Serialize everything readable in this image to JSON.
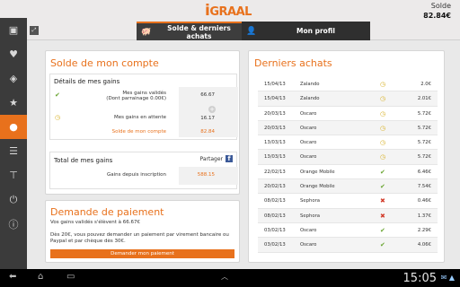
{
  "logo": {
    "first": "i",
    "rest": "GRAAL"
  },
  "header": {
    "solde_label": "Solde",
    "solde_value": "82.84€"
  },
  "tabs": [
    {
      "label": "Solde & derniers achats",
      "icon": "piggy-bank-icon",
      "active": true
    },
    {
      "label": "Mon profil",
      "icon": "person-icon",
      "active": false
    }
  ],
  "sidebar": {
    "items": [
      {
        "icon": "store-icon",
        "glyph": "▣"
      },
      {
        "icon": "heart-icon",
        "glyph": "♥"
      },
      {
        "icon": "tag-icon",
        "glyph": "◈"
      },
      {
        "icon": "star-icon",
        "glyph": "★"
      },
      {
        "icon": "user-icon",
        "glyph": "●",
        "active": true
      },
      {
        "icon": "list-icon",
        "glyph": "☰"
      },
      {
        "icon": "signpost-icon",
        "glyph": "⊤"
      },
      {
        "icon": "power-icon",
        "glyph": "⏻"
      },
      {
        "icon": "info-icon",
        "glyph": "ⓘ"
      }
    ],
    "expand_glyph": "⤢"
  },
  "solde": {
    "title": "Solde de mon compte",
    "details_title": "Détails de mes gains",
    "validated_label_1": "Mes gains validés",
    "validated_label_2": "(Dont parrainage 0.00€)",
    "validated_value": "66.67",
    "pending_label": "Mes gains en attente",
    "pending_value": "16.17",
    "balance_label": "Solde de mon compte",
    "balance_value": "82.84",
    "total_title": "Total de mes gains",
    "share_label": "Partager",
    "since_label": "Gains depuis inscription",
    "since_value": "588.15"
  },
  "paiement": {
    "title": "Demande de paiement",
    "line1": "Vos gains validés s'élèvent à 66.67€",
    "line2": "Dès 20€, vous pouvez demander un paiement par virement bancaire ou",
    "line3": "Paypal et par chèque dès 30€.",
    "button_label": "Demander mon paiement"
  },
  "achats": {
    "title": "Derniers achats",
    "rows": [
      {
        "date": "15/04/13",
        "shop": "Zalando",
        "status": "pending",
        "amount": "2.0€"
      },
      {
        "date": "15/04/13",
        "shop": "Zalando",
        "status": "pending",
        "amount": "2.01€"
      },
      {
        "date": "20/03/13",
        "shop": "Oscaro",
        "status": "pending",
        "amount": "5.72€"
      },
      {
        "date": "20/03/13",
        "shop": "Oscaro",
        "status": "pending",
        "amount": "5.72€"
      },
      {
        "date": "13/03/13",
        "shop": "Oscaro",
        "status": "pending",
        "amount": "5.72€"
      },
      {
        "date": "13/03/13",
        "shop": "Oscaro",
        "status": "pending",
        "amount": "5.72€"
      },
      {
        "date": "22/02/13",
        "shop": "Orange Mobile",
        "status": "validated",
        "amount": "6.46€"
      },
      {
        "date": "20/02/13",
        "shop": "Orange Mobile",
        "status": "validated",
        "amount": "7.54€"
      },
      {
        "date": "08/02/13",
        "shop": "Sephora",
        "status": "refused",
        "amount": "0.46€"
      },
      {
        "date": "08/02/13",
        "shop": "Sephora",
        "status": "refused",
        "amount": "1.37€"
      },
      {
        "date": "03/02/13",
        "shop": "Oscaro",
        "status": "validated",
        "amount": "2.29€"
      },
      {
        "date": "03/02/13",
        "shop": "Oscaro",
        "status": "validated",
        "amount": "4.06€"
      }
    ]
  },
  "status_glyphs": {
    "pending": "◷",
    "validated": "✔",
    "refused": "✖"
  },
  "status_colors": {
    "accent": "#e8711c",
    "validated": "#69a531",
    "pending": "#d9b32c",
    "refused": "#d23b2a"
  },
  "system": {
    "time": "15:05",
    "back_icon": "⬅",
    "home_icon": "⌂",
    "recents_icon": "▭",
    "status_icons": "✉ ▲"
  }
}
